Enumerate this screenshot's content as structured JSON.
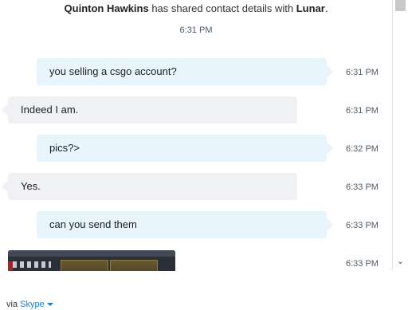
{
  "system_message": {
    "sender": "Quinton Hawkins",
    "text": " has shared contact details with ",
    "target": "Lunar",
    "suffix": ".",
    "time": "6:31 PM"
  },
  "messages": [
    {
      "direction": "out",
      "text": "you selling a csgo account?",
      "time": "6:31 PM"
    },
    {
      "direction": "in",
      "text": "Indeed I am.",
      "time": "6:31 PM"
    },
    {
      "direction": "out",
      "text": "pics?>",
      "time": "6:32 PM"
    },
    {
      "direction": "in",
      "text": "Yes.",
      "time": "6:33 PM"
    },
    {
      "direction": "out",
      "text": "can you send them",
      "time": "6:33 PM"
    },
    {
      "direction": "in",
      "type": "image",
      "time": "6:33 PM"
    }
  ],
  "footer": {
    "via": "via",
    "service": "Skype"
  },
  "scrollbar": {
    "down_glyph": "⌄"
  }
}
